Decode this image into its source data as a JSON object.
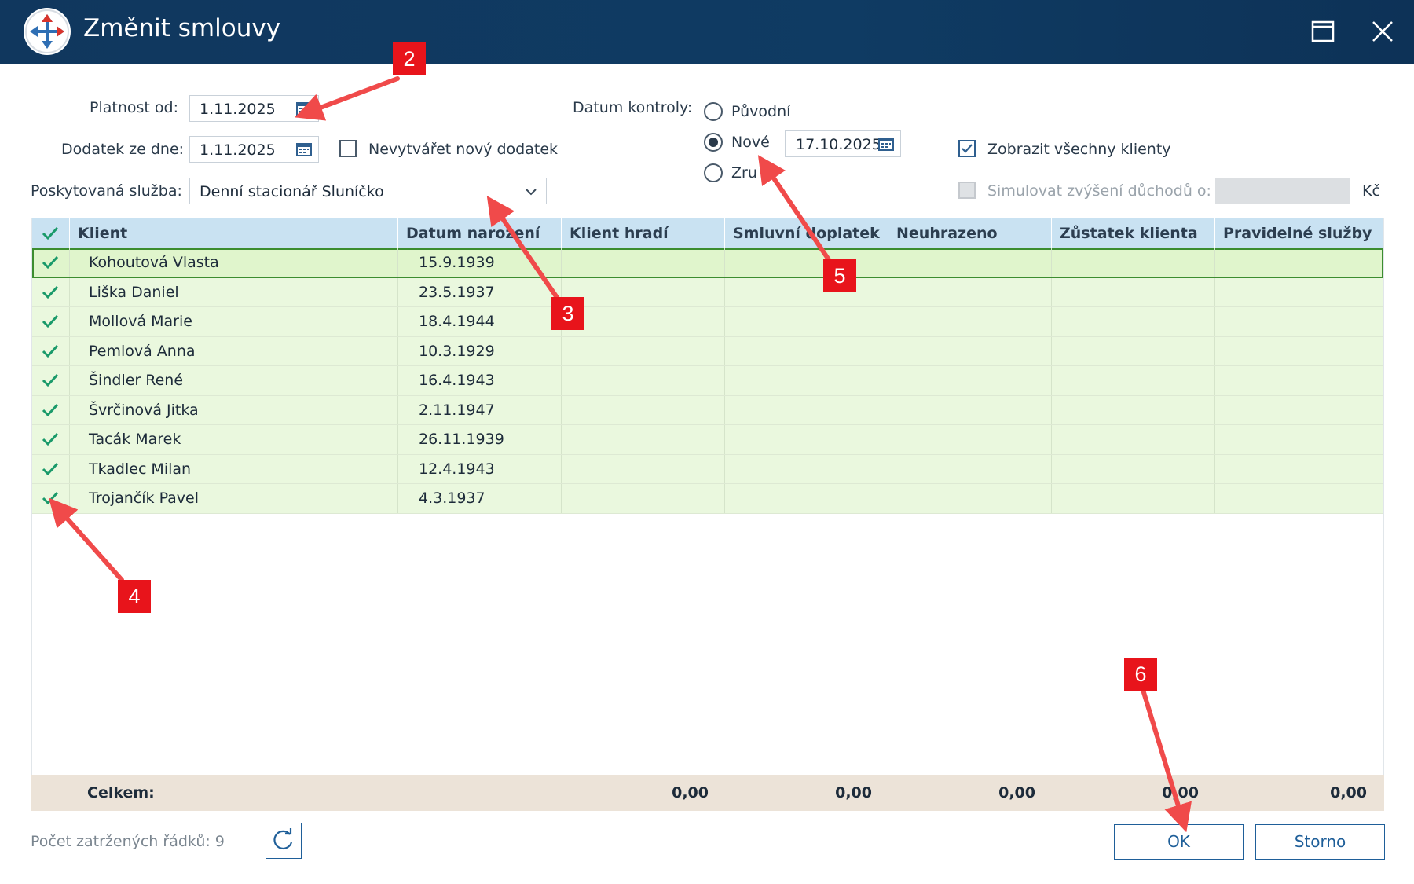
{
  "window": {
    "title": "Změnit smlouvy"
  },
  "form": {
    "platnost_od_label": "Platnost od:",
    "platnost_od_value": "1.11.2025",
    "dodatek_label": "Dodatek ze dne:",
    "dodatek_value": "1.11.2025",
    "nevytvaret_label": "Nevytvářet nový dodatek",
    "sluzba_label": "Poskytovaná služba:",
    "sluzba_value": "Denní stacionář Sluníčko",
    "datum_kontroly_label": "Datum kontroly:",
    "radio_puvodni": "Původní",
    "radio_nove": "Nové",
    "radio_zrusit": "Zru",
    "nove_date": "17.10.2025",
    "zobrazit_label": "Zobrazit všechny klienty",
    "simulovat_label": "Simulovat zvýšení důchodů o:",
    "simulovat_unit": "Kč"
  },
  "table": {
    "columns": [
      "Klient",
      "Datum narození",
      "Klient hradí",
      "Smluvní doplatek",
      "Neuhrazeno",
      "Zůstatek klienta",
      "Pravidelné služby"
    ],
    "rows": [
      {
        "name": "Kohoutová Vlasta",
        "dob": "15.9.1939"
      },
      {
        "name": "Liška Daniel",
        "dob": "23.5.1937"
      },
      {
        "name": "Mollová Marie",
        "dob": "18.4.1944"
      },
      {
        "name": "Pemlová Anna",
        "dob": "10.3.1929"
      },
      {
        "name": "Šindler René",
        "dob": "16.4.1943"
      },
      {
        "name": "Švrčinová Jitka",
        "dob": "2.11.1947"
      },
      {
        "name": "Tacák Marek",
        "dob": "26.11.1939"
      },
      {
        "name": "Tkadlec Milan",
        "dob": "12.4.1943"
      },
      {
        "name": "Trojančík Pavel",
        "dob": "4.3.1937"
      }
    ],
    "totals_label": "Celkem:",
    "totals": [
      "0,00",
      "0,00",
      "0,00",
      "0,00",
      "0,00"
    ]
  },
  "footer": {
    "count_label": "Počet zatržených řádků: 9",
    "ok": "OK",
    "storno": "Storno"
  },
  "annotations": [
    "2",
    "3",
    "4",
    "5",
    "6"
  ],
  "colors": {
    "titlebar": "#10375e",
    "header": "#c9e2f2",
    "row": "#eaf8de",
    "check": "#1a9a6a",
    "badge": "#e8141b",
    "arrow": "#f04a4a"
  }
}
